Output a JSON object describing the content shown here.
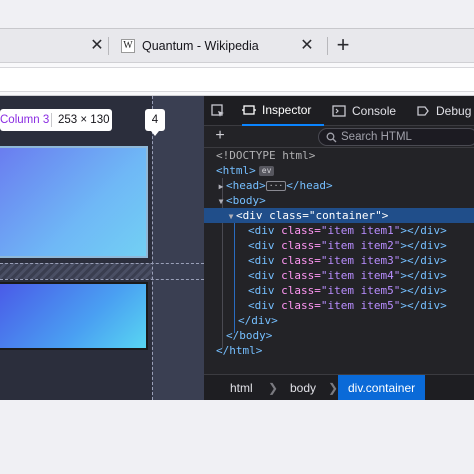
{
  "browser": {
    "tabs": [
      {
        "title": "",
        "close_glyph": "✕"
      },
      {
        "title": "Quantum - Wikipedia",
        "favicon": "W",
        "close_glyph": "✕"
      }
    ],
    "new_tab_glyph": "+"
  },
  "viewport": {
    "grid_badge": {
      "name": "Column 3",
      "dims": "253 × 130"
    },
    "line_number": "4"
  },
  "devtools": {
    "tools": [
      {
        "id": "picker",
        "label": ""
      },
      {
        "id": "inspector",
        "label": "Inspector",
        "icon": "inspector-icon"
      },
      {
        "id": "console",
        "label": "Console",
        "icon": "console-icon"
      },
      {
        "id": "debugger",
        "label": "Debug",
        "icon": "debugger-icon"
      }
    ],
    "add_node_glyph": "+",
    "search_placeholder": "Search HTML",
    "markup": {
      "doctype": "<!DOCTYPE html>",
      "html_open_tag": "<html>",
      "event_badge": "ev",
      "head_open": "<head>",
      "ellipsis": "···",
      "head_close": "</head>",
      "body_open": "<body>",
      "div_open_prefix": "<div ",
      "class_attr": "class=",
      "container_value": "\"container\"",
      "gt": ">",
      "items": [
        {
          "value": "\"item item1\""
        },
        {
          "value": "\"item item2\""
        },
        {
          "value": "\"item item3\""
        },
        {
          "value": "\"item item4\""
        },
        {
          "value": "\"item item5\""
        },
        {
          "value": "\"item item5\""
        }
      ],
      "div_close": "</div>",
      "body_close": "</body>",
      "html_close": "</html>"
    },
    "breadcrumbs": [
      "html",
      "body",
      "div.container"
    ],
    "crumb_sep": "❯"
  },
  "colors": {
    "selection": "#204e8a",
    "active_crumb": "#0a6ad8",
    "tag": "#75bfff",
    "attr": "#ff97f3",
    "value": "#b98eff"
  }
}
